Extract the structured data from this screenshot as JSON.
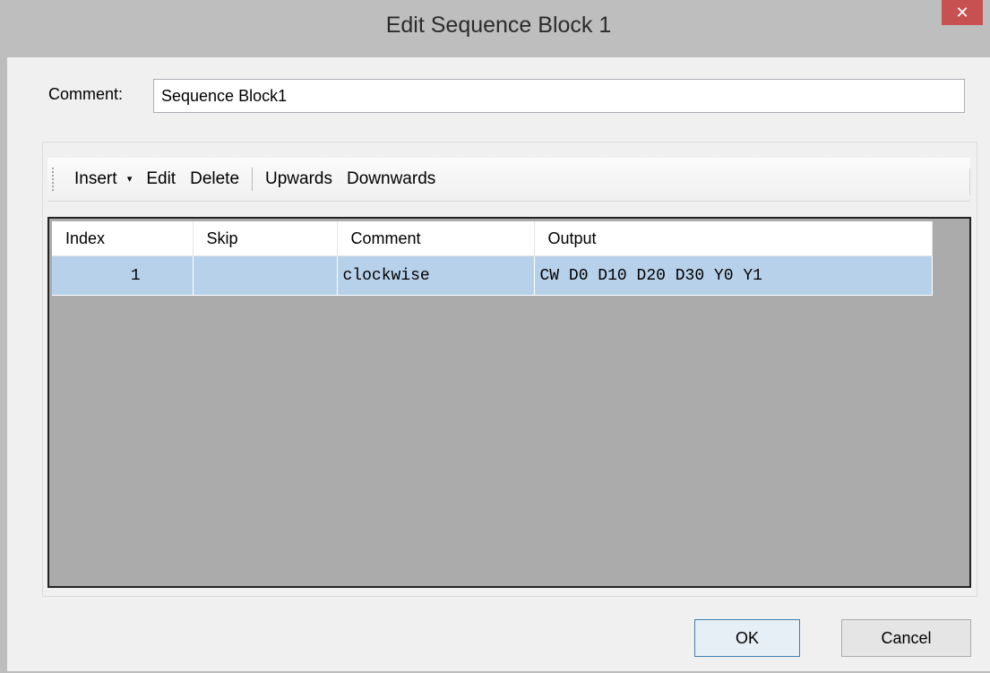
{
  "window": {
    "title": "Edit Sequence Block 1",
    "close_glyph": "✕"
  },
  "comment": {
    "label": "Comment:",
    "value": "Sequence Block1"
  },
  "toolbar": {
    "insert": "Insert",
    "insert_arrow": "▾",
    "edit": "Edit",
    "delete": "Delete",
    "upwards": "Upwards",
    "downwards": "Downwards"
  },
  "table": {
    "columns": [
      "Index",
      "Skip",
      "Comment",
      "Output"
    ],
    "rows": [
      {
        "index": "1",
        "skip": "",
        "comment": "clockwise",
        "output": "CW D0 D10 D20 D30 Y0 Y1"
      }
    ]
  },
  "buttons": {
    "ok": "OK",
    "cancel": "Cancel"
  },
  "colors": {
    "selected_row": "#b8d1ea",
    "grid_background": "#ababab",
    "close_button": "#c75050"
  }
}
